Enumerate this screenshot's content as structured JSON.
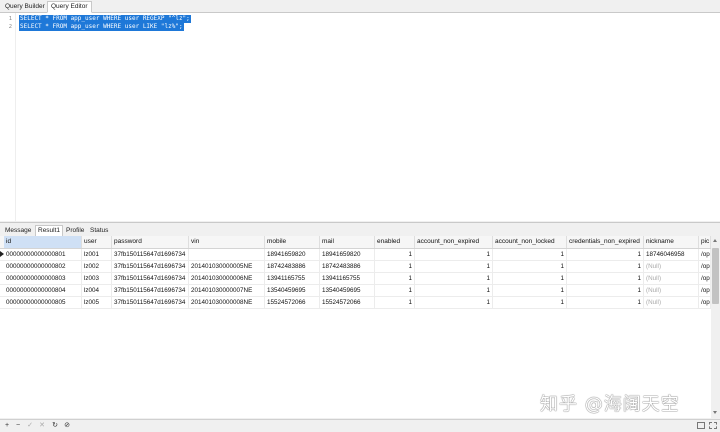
{
  "tabs": [
    {
      "label": "Query Builder",
      "active": false
    },
    {
      "label": "Query Editor",
      "active": true
    }
  ],
  "editor": {
    "lines": [
      {
        "num": "1",
        "text": "SELECT * FROM app_user WHERE user REGEXP \"^lz\";"
      },
      {
        "num": "2",
        "text": "SELECT * FROM app_user WHERE user LIKE \"lz%\";"
      }
    ]
  },
  "result_tabs": [
    {
      "label": "Message",
      "active": false
    },
    {
      "label": "Result1",
      "active": true
    },
    {
      "label": "Profile",
      "active": false
    },
    {
      "label": "Status",
      "active": false
    }
  ],
  "grid": {
    "columns": [
      "id",
      "user",
      "password",
      "vin",
      "mobile",
      "mail",
      "enabled",
      "account_non_expired",
      "account_non_locked",
      "credentials_non_expired",
      "nickname",
      "pic"
    ],
    "rows": [
      [
        "00000000000000801",
        "lz001",
        "37fb150115647d1696734",
        "",
        "18941659820",
        "18941659820",
        "1",
        "1",
        "1",
        "1",
        "18746046958",
        "/op"
      ],
      [
        "00000000000000802",
        "lz002",
        "37fb150115647d1696734",
        "201401030000005NE",
        "18742483886",
        "18742483886",
        "1",
        "1",
        "1",
        "1",
        "(Null)",
        "/op"
      ],
      [
        "00000000000000803",
        "lz003",
        "37fb150115647d1696734",
        "201401030000006NE",
        "13941165755",
        "13941165755",
        "1",
        "1",
        "1",
        "1",
        "(Null)",
        "/op"
      ],
      [
        "00000000000000804",
        "lz004",
        "37fb150115647d1696734",
        "201401030000007NE",
        "13540459695",
        "13540459695",
        "1",
        "1",
        "1",
        "1",
        "(Null)",
        "/op"
      ],
      [
        "00000000000000805",
        "lz005",
        "37fb150115647d1696734",
        "201401030000008NE",
        "15524572066",
        "15524572066",
        "1",
        "1",
        "1",
        "1",
        "(Null)",
        "/op"
      ]
    ]
  },
  "statusbar": {
    "add": "+",
    "remove": "−",
    "apply": "✓",
    "discard": "✕",
    "refresh": "↻",
    "stop": "⊘"
  },
  "watermark": "知乎 @海阔天空",
  "colors": {
    "selection": "#1e78d8",
    "header_selected": "#cfe0f5"
  }
}
